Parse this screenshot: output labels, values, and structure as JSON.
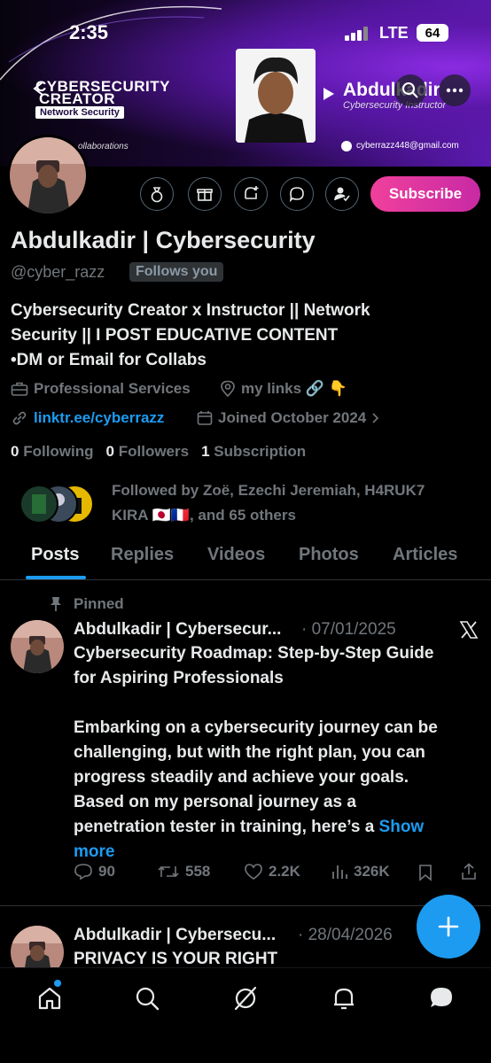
{
  "status_bar": {
    "time": "2:35",
    "network": "LTE",
    "battery": "64"
  },
  "banner": {
    "title_line1": "CYBERSECURITY",
    "title_line2": "CREATOR",
    "badge": "Network Security",
    "collab_text": "ollaborations",
    "brand_name": "Abdulkadir",
    "brand_subtitle": "Cybersecurity Instructor",
    "email": "cyberrazz448@gmail.com"
  },
  "profile": {
    "display_name": "Abdulkadir | Cybersecurity",
    "handle": "@cyber_razz",
    "follows_you": "Follows you",
    "bio_lines": [
      "Cybersecurity Creator x Instructor || Network",
      "Security || I POST EDUCATIVE CONTENT",
      "•DM or Email for Collabs"
    ],
    "category": "Professional Services",
    "location": "my links 🔗 👇",
    "website": "linktr.ee/cyberrazz",
    "joined": "Joined October 2024",
    "following_count": "0",
    "following_label": "Following",
    "followers_count": "0",
    "followers_label": "Followers",
    "subscriptions_count": "1",
    "subscriptions_label": "Subscription",
    "followed_by_line1": "Followed by Zoë, Ezechi Jeremiah, H4RUK7",
    "followed_by_line2": "KIRA 🇯🇵🇫🇷, and 65 others",
    "subscribe_label": "Subscribe"
  },
  "tabs": [
    {
      "label": "Posts",
      "active": true
    },
    {
      "label": "Replies",
      "active": false
    },
    {
      "label": "Videos",
      "active": false
    },
    {
      "label": "Photos",
      "active": false
    },
    {
      "label": "Articles",
      "active": false
    }
  ],
  "posts": [
    {
      "pinned_label": "Pinned",
      "author": "Abdulkadir | Cybersecur...",
      "date": "· 07/01/2025",
      "lines": [
        "Cybersecurity Roadmap: Step-by-Step Guide",
        "for Aspiring Professionals",
        "",
        "Embarking on a cybersecurity journey can be",
        "challenging, but with the right plan, you can",
        "progress steadily and achieve your goals.",
        "Based on my personal journey as a",
        "penetration tester in training, here’s a"
      ],
      "show_more_1": "Show",
      "show_more_2": "more",
      "replies": "90",
      "reposts": "558",
      "likes": "2.2K",
      "views": "326K"
    },
    {
      "author": "Abdulkadir | Cybersecu...",
      "date": "· 28/04/2026",
      "lines": [
        "PRIVACY IS YOUR RIGHT"
      ]
    }
  ],
  "colors": {
    "accent": "#1d9bf0",
    "subscribe_start": "#f0409c",
    "subscribe_end": "#c82aa4",
    "muted": "#71767b"
  }
}
